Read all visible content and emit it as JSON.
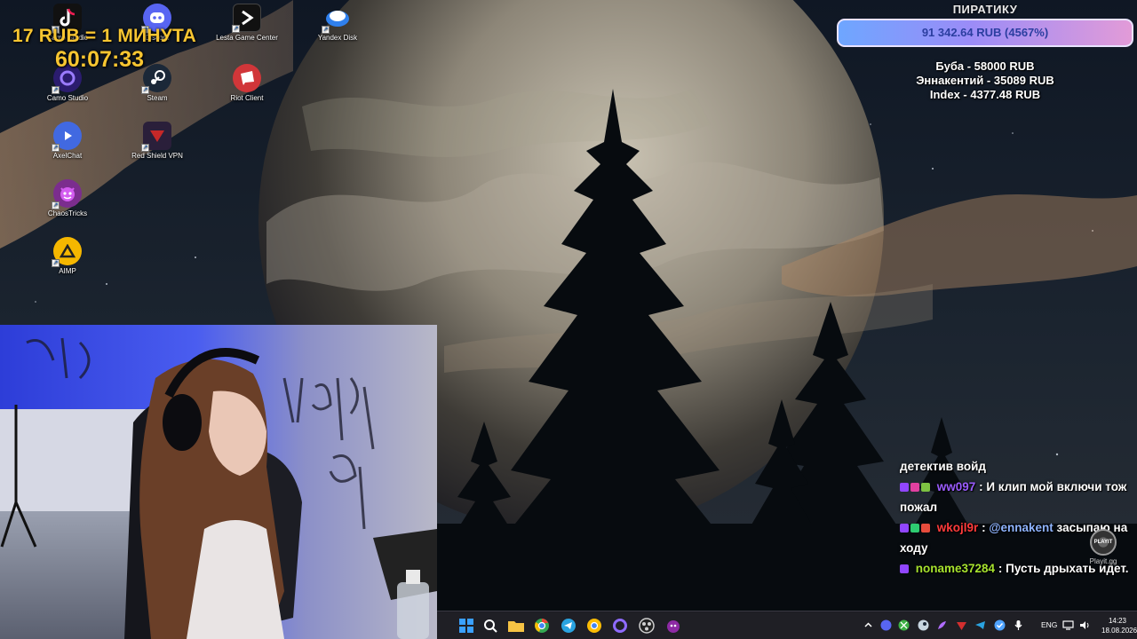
{
  "desktop_icons": [
    {
      "label": "Camo Studio",
      "icon": "tiktok-live-studio-icon",
      "color": "#ee1d52"
    },
    {
      "label": "Discord",
      "icon": "discord-icon",
      "color": "#5865f2"
    },
    {
      "label": "Lesta Game Center",
      "icon": "lesta-game-center-icon",
      "color": "#111111"
    },
    {
      "label": "Yandex Disk",
      "icon": "yandex-disk-icon",
      "color": "#2f80ed"
    },
    {
      "label": "Camo Studio",
      "icon": "camo-studio-icon",
      "color": "#5b3fd6"
    },
    {
      "label": "Steam",
      "icon": "steam-icon",
      "color": "#1b2838"
    },
    {
      "label": "Riot Client",
      "icon": "riot-client-icon",
      "color": "#d13639"
    },
    {
      "label": "AxelChat",
      "icon": "axelchat-icon",
      "color": "#4169e1"
    },
    {
      "label": "Red Shield VPN",
      "icon": "red-shield-vpn-icon",
      "color": "#c62828"
    },
    {
      "label": "ChaosTricks",
      "icon": "chaostricks-icon",
      "color": "#7b2d8e"
    },
    {
      "label": "AIMP",
      "icon": "aimp-icon",
      "color": "#f5b700"
    }
  ],
  "timer": {
    "rate": "17 RUB = 1 МИНУТА",
    "clock": "60:07:33",
    "color": "#f7c531"
  },
  "goal": {
    "title": "ПИРАТИКУ",
    "amount": "91 342.64 RUB (4567%)",
    "progress_percent": 4567,
    "bar_colors": [
      "#6ea6ff",
      "#9b8cf7",
      "#e29bd8"
    ]
  },
  "donors": [
    "Буба - 58000 RUB",
    "Эннакентий - 35089 RUB",
    "Index - 4377.48 RUB"
  ],
  "chat": {
    "messages": [
      {
        "user": "",
        "user_color": "#ffffff",
        "badges": [],
        "text": "детектив войд"
      },
      {
        "user": "ww097",
        "user_color": "#9a5cff",
        "badges": [
          "#9146ff",
          "#e040a0",
          "#7dc242"
        ],
        "text": "И клип мой включи тож пожал"
      },
      {
        "user": "wkojl9r",
        "user_color": "#ff3b3b",
        "badges": [
          "#9146ff",
          "#2ecc71",
          "#e74c3c"
        ],
        "mention": "@ennakent",
        "mention_color": "#8fb4ff",
        "text": "засыпаю на ходу"
      },
      {
        "user": "noname37284",
        "user_color": "#a6e22e",
        "badges": [
          "#9146ff"
        ],
        "text": "Пусть дрыхать идет."
      }
    ],
    "widget_label": "Playit.gg",
    "widget_logo": "PLAYIT"
  },
  "taskbar": {
    "apps": [
      {
        "icon": "windows-start-icon",
        "color": "#3aa0ff"
      },
      {
        "icon": "search-icon",
        "color": "#ffffff"
      },
      {
        "icon": "file-explorer-icon",
        "color": "#f6c344"
      },
      {
        "icon": "chrome-icon",
        "color": "#34a853"
      },
      {
        "icon": "telegram-icon",
        "color": "#2aa3e0"
      },
      {
        "icon": "chrome-profile-icon",
        "color": "#fbbc05"
      },
      {
        "icon": "camo-icon",
        "color": "#6f4bd8"
      },
      {
        "icon": "obs-icon",
        "color": "#cfcfcf"
      },
      {
        "icon": "chaostricks-icon",
        "color": "#8e2aa5"
      }
    ],
    "tray_icons": [
      {
        "icon": "chevron-up-icon",
        "color": "#ffffff"
      },
      {
        "icon": "discord-tray-icon",
        "color": "#5865f2"
      },
      {
        "icon": "xbox-icon",
        "color": "#3cb043"
      },
      {
        "icon": "steam-tray-icon",
        "color": "#c7d5e0"
      },
      {
        "icon": "feather-icon",
        "color": "#b06cff"
      },
      {
        "icon": "red-shield-tray-icon",
        "color": "#d32f2f"
      },
      {
        "icon": "telegram-tray-icon",
        "color": "#2aa3e0"
      },
      {
        "icon": "check-shield-icon",
        "color": "#4fa3ff"
      },
      {
        "icon": "microphone-icon",
        "color": "#ffffff"
      }
    ],
    "language": "ENG",
    "time": "14:23",
    "date": "18.08.2026"
  }
}
